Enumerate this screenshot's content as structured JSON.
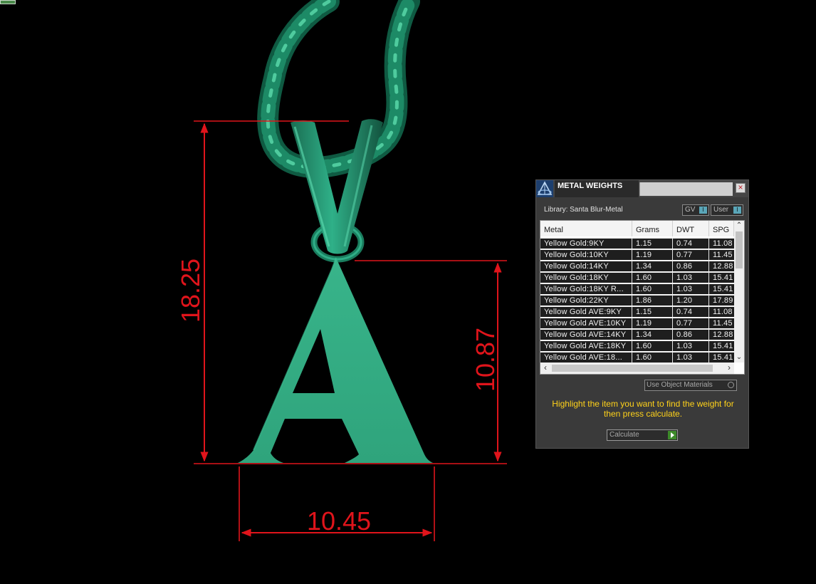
{
  "viewport": {
    "dimensions": {
      "total_height": "18.25",
      "letter_height": "10.87",
      "width": "10.45"
    },
    "colors": {
      "model": "#33ad85",
      "chain": "#1f8f6a",
      "dimension": "#e0141b"
    }
  },
  "panel": {
    "title": "METAL WEIGHTS",
    "close_icon": "×",
    "library_label": "Library: Santa Blur-Metal",
    "toggle_gv": "GV",
    "toggle_user": "User",
    "columns": [
      "Metal",
      "Grams",
      "DWT",
      "SPG"
    ],
    "rows": [
      [
        "Yellow Gold:9KY",
        "1.15",
        "0.74",
        "11.08"
      ],
      [
        "Yellow Gold:10KY",
        "1.19",
        "0.77",
        "11.45"
      ],
      [
        "Yellow Gold:14KY",
        "1.34",
        "0.86",
        "12.88"
      ],
      [
        "Yellow Gold:18KY",
        "1.60",
        "1.03",
        "15.41"
      ],
      [
        "Yellow Gold:18KY R...",
        "1.60",
        "1.03",
        "15.41"
      ],
      [
        "Yellow Gold:22KY",
        "1.86",
        "1.20",
        "17.89"
      ],
      [
        "Yellow Gold AVE:9KY",
        "1.15",
        "0.74",
        "11.08"
      ],
      [
        "Yellow Gold AVE:10KY",
        "1.19",
        "0.77",
        "11.45"
      ],
      [
        "Yellow Gold AVE:14KY",
        "1.34",
        "0.86",
        "12.88"
      ],
      [
        "Yellow Gold AVE:18KY",
        "1.60",
        "1.03",
        "15.41"
      ],
      [
        "Yellow Gold AVE:18...",
        "1.60",
        "1.03",
        "15.41"
      ]
    ],
    "use_object_materials": "Use Object Materials",
    "instruction": "Highlight the item you want to find the weight for then press calculate.",
    "calculate_label": "Calculate"
  }
}
